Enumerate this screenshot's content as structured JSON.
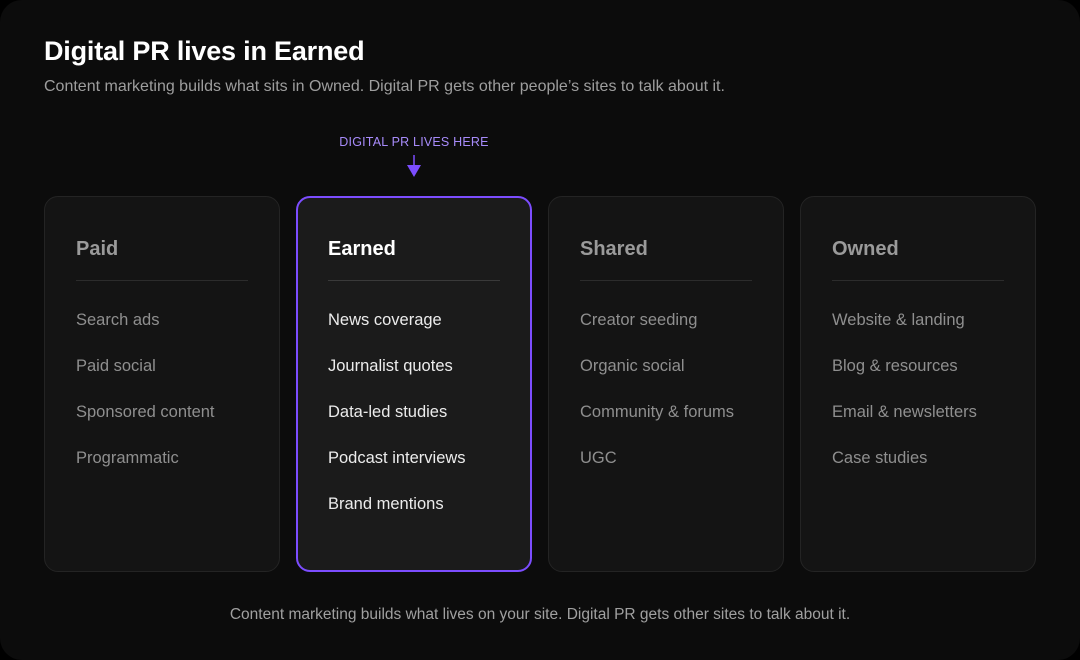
{
  "header": {
    "title": "Digital PR lives in Earned",
    "subtitle": "Content marketing builds what sits in Owned. Digital PR gets other people’s sites to talk about it."
  },
  "callout": {
    "label": "DIGITAL PR LIVES HERE",
    "color": "#a78bfa"
  },
  "colors": {
    "accent": "#7c4dff",
    "background": "#0c0c0c",
    "card": "#141414"
  },
  "cards": [
    {
      "title": "Paid",
      "highlighted": false,
      "items": [
        "Search ads",
        "Paid social",
        "Sponsored content",
        "Programmatic"
      ]
    },
    {
      "title": "Earned",
      "highlighted": true,
      "items": [
        "News coverage",
        "Journalist quotes",
        "Data-led studies",
        "Podcast interviews",
        "Brand mentions"
      ]
    },
    {
      "title": "Shared",
      "highlighted": false,
      "items": [
        "Creator seeding",
        "Organic social",
        "Community & forums",
        "UGC"
      ]
    },
    {
      "title": "Owned",
      "highlighted": false,
      "items": [
        "Website & landing",
        "Blog & resources",
        "Email & newsletters",
        "Case studies"
      ]
    }
  ],
  "footer": {
    "text": "Content marketing builds what lives on your site. Digital PR gets other sites to talk about it."
  }
}
